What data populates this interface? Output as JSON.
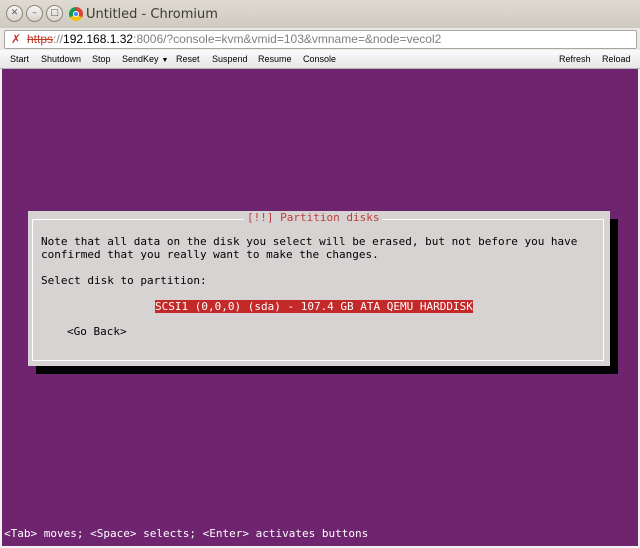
{
  "window": {
    "title": "Untitled - Chromium",
    "controls": {
      "close_icon": "close-icon",
      "minimize_icon": "minimize-icon",
      "maximize_icon": "maximize-icon"
    }
  },
  "address_bar": {
    "insecure_icon": "insecure-x-icon",
    "scheme": "https",
    "separator": "://",
    "host": "192.168.1.32",
    "rest": ":8006/?console=kvm&vmid=103&vmname=&node=vecol2"
  },
  "toolbar": {
    "start": "Start",
    "shutdown": "Shutdown",
    "stop": "Stop",
    "sendkey": "SendKey",
    "reset": "Reset",
    "suspend": "Suspend",
    "resume": "Resume",
    "console": "Console",
    "refresh": "Refresh",
    "reload": "Reload"
  },
  "console": {
    "dialog": {
      "title": "[!!] Partition disks",
      "message_line1": "Note that all data on the disk you select will be erased, but not before you have",
      "message_line2": "confirmed that you really want to make the changes.",
      "select_label": "Select disk to partition:",
      "disk_option": "SCSI1 (0,0,0) (sda) - 107.4 GB ATA QEMU HARDDISK",
      "go_back": "<Go Back>"
    },
    "status_line": "<Tab> moves; <Space> selects; <Enter> activates buttons"
  },
  "colors": {
    "console_background": "#6f2470",
    "dialog_background": "#d7d3d3",
    "selection": "#c42929",
    "dialog_title": "#c03c3c"
  }
}
